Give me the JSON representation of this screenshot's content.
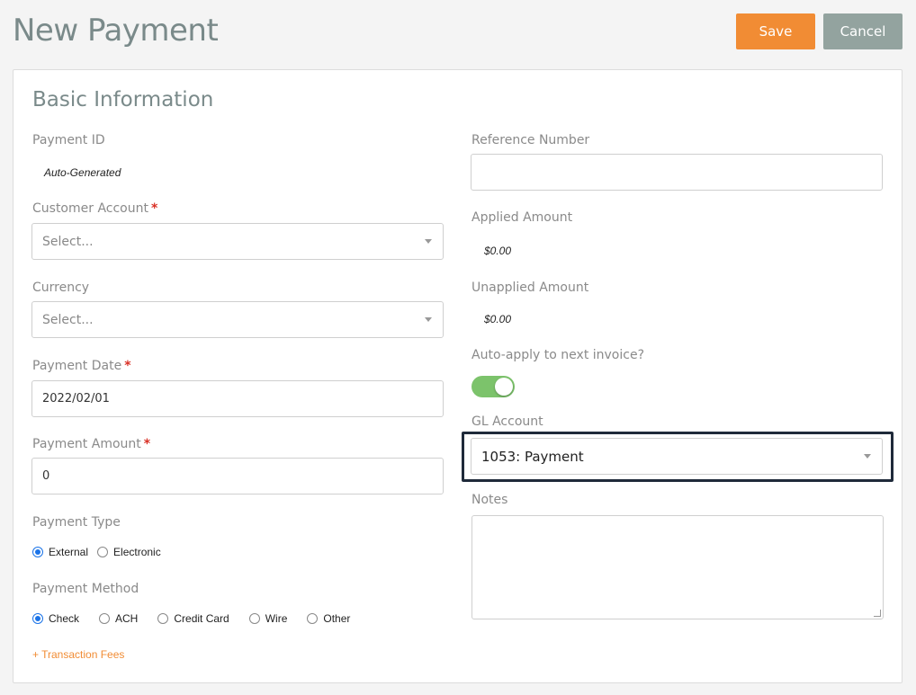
{
  "header": {
    "title": "New Payment",
    "save_label": "Save",
    "cancel_label": "Cancel"
  },
  "section": {
    "title": "Basic Information"
  },
  "left": {
    "payment_id": {
      "label": "Payment ID",
      "value": "Auto-Generated"
    },
    "customer_account": {
      "label": "Customer Account",
      "required": "*",
      "placeholder": "Select..."
    },
    "currency": {
      "label": "Currency",
      "placeholder": "Select..."
    },
    "payment_date": {
      "label": "Payment Date",
      "required": "*",
      "value": "2022/02/01"
    },
    "payment_amount": {
      "label": "Payment Amount",
      "required": "*",
      "value": "0"
    },
    "payment_type": {
      "label": "Payment Type",
      "options": [
        "External",
        "Electronic"
      ],
      "selected": "External"
    },
    "payment_method": {
      "label": "Payment Method",
      "options": [
        "Check",
        "ACH",
        "Credit Card",
        "Wire",
        "Other"
      ],
      "selected": "Check"
    },
    "transaction_fees_link": "+ Transaction Fees"
  },
  "right": {
    "reference_number": {
      "label": "Reference Number",
      "value": ""
    },
    "applied_amount": {
      "label": "Applied Amount",
      "value": "$0.00"
    },
    "unapplied_amount": {
      "label": "Unapplied Amount",
      "value": "$0.00"
    },
    "auto_apply": {
      "label": "Auto-apply to next invoice?",
      "enabled": true
    },
    "gl_account": {
      "label": "GL Account",
      "value": "1053: Payment"
    },
    "notes": {
      "label": "Notes",
      "value": ""
    }
  },
  "colors": {
    "accent": "#f18c34",
    "cancel": "#93a39f",
    "toggle_on": "#7cc36b",
    "highlight_border": "#1f2a3a"
  }
}
